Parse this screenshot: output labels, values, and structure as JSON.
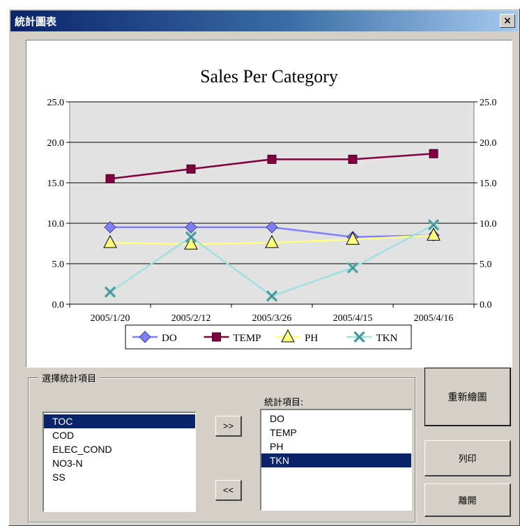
{
  "window": {
    "title": "統計圖表",
    "close_label": "×"
  },
  "chart_data": {
    "type": "line",
    "title": "Sales Per Category",
    "categories": [
      "2005/1/20",
      "2005/2/12",
      "2005/3/26",
      "2005/4/15",
      "2005/4/16"
    ],
    "ylim": [
      0,
      25
    ],
    "y_ticks": [
      "0.0",
      "5.0",
      "10.0",
      "15.0",
      "20.0",
      "25.0"
    ],
    "grid": true,
    "legend_position": "bottom",
    "series": [
      {
        "name": "DO",
        "values": [
          9.5,
          9.5,
          9.5,
          8.3,
          8.5
        ],
        "color": "#8080ff",
        "marker": "diamond",
        "marker_color": "#8080ff"
      },
      {
        "name": "TEMP",
        "values": [
          15.5,
          16.7,
          17.9,
          17.9,
          18.6
        ],
        "color": "#800040",
        "marker": "square",
        "marker_color": "#800040"
      },
      {
        "name": "PH",
        "values": [
          7.6,
          7.4,
          7.6,
          8.0,
          8.5
        ],
        "color": "#ffff80",
        "marker": "triangle",
        "marker_color": "#ffff80"
      },
      {
        "name": "TKN",
        "values": [
          1.5,
          8.3,
          1.0,
          4.5,
          9.8
        ],
        "color": "#a0e0e0",
        "marker": "x",
        "marker_color": "#6fbfbf"
      }
    ]
  },
  "selection": {
    "group_label": "選擇統計項目",
    "available_items": [
      "TOC",
      "COD",
      "ELEC_COND",
      "NO3-N",
      "SS"
    ],
    "available_selected": "TOC",
    "stats_label": "統計項目:",
    "stats_items": [
      "DO",
      "TEMP",
      "PH",
      "TKN"
    ],
    "stats_selected": "TKN",
    "add_label": ">>",
    "remove_label": "<<"
  },
  "buttons": {
    "redraw": "重新繪圖",
    "print": "列印",
    "close": "離開"
  }
}
